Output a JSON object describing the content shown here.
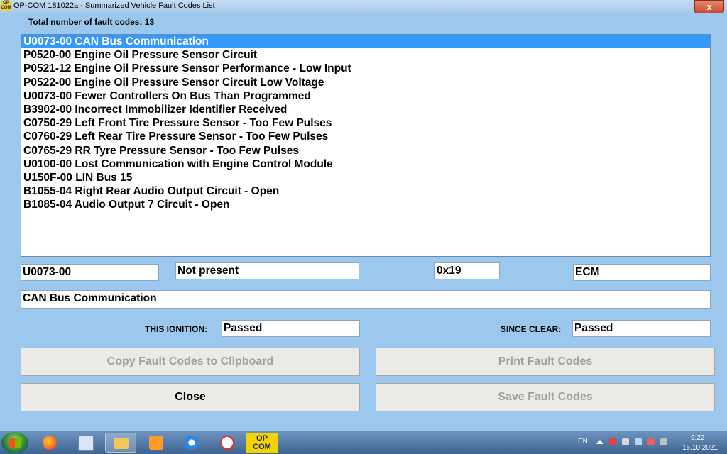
{
  "window": {
    "title": "OP-COM 181022a - Summarized Vehicle Fault Codes List",
    "app_icon_text": "OP COM",
    "close_glyph": "x"
  },
  "summary": {
    "total_label": "Total number of fault codes: 13"
  },
  "fault_codes": [
    "U0073-00 CAN Bus Communication",
    "P0520-00 Engine Oil Pressure Sensor Circuit",
    "P0521-12 Engine Oil Pressure Sensor Performance - Low Input",
    "P0522-00 Engine Oil Pressure Sensor Circuit Low Voltage",
    "U0073-00 Fewer Controllers On Bus Than Programmed",
    "B3902-00 Incorrect Immobilizer Identifier Received",
    "C0750-29 Left Front Tire Pressure Sensor - Too Few Pulses",
    "C0760-29 Left Rear Tire Pressure Sensor - Too Few Pulses",
    "C0765-29 RR Tyre Pressure Sensor - Too Few Pulses",
    "U0100-00 Lost Communication with Engine Control Module",
    "U150F-00 LIN Bus 15",
    "B1055-04 Right Rear Audio Output Circuit - Open",
    "B1085-04 Audio Output 7 Circuit - Open"
  ],
  "selected_index": 0,
  "details": {
    "code": "U0073-00",
    "status": "Not present",
    "hex": "0x19",
    "module": "ECM",
    "description": "CAN Bus Communication",
    "this_ignition_label": "THIS IGNITION:",
    "this_ignition_value": "Passed",
    "since_clear_label": "SINCE CLEAR:",
    "since_clear_value": "Passed"
  },
  "buttons": {
    "copy": "Copy Fault Codes to Clipboard",
    "print": "Print Fault Codes",
    "close": "Close",
    "save": "Save Fault Codes"
  },
  "taskbar": {
    "opcom_label": "OP COM",
    "language": "EN",
    "time": "9:22",
    "date": "15.10.2021"
  }
}
